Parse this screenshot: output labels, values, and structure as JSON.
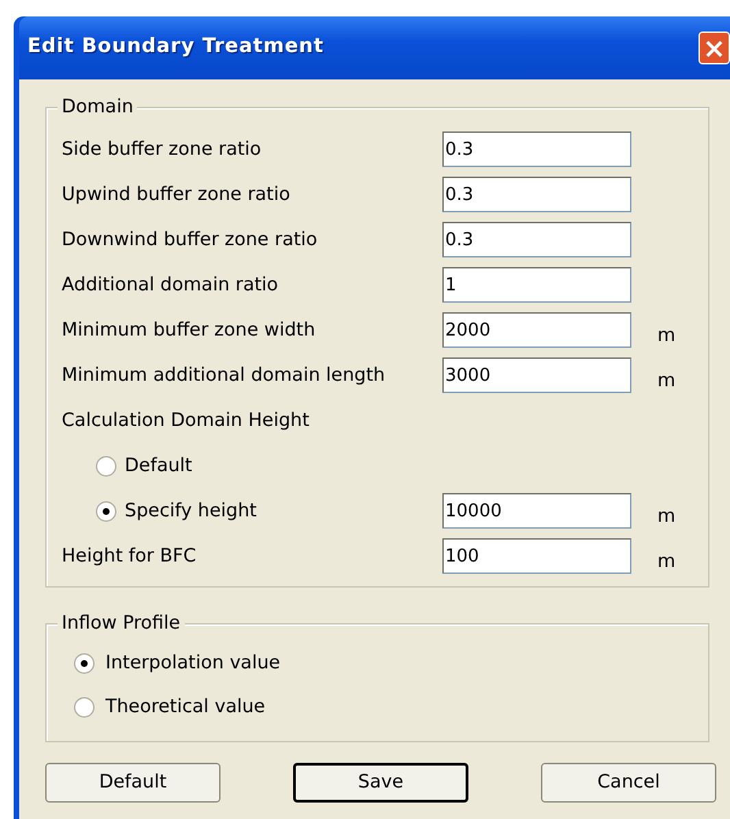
{
  "window": {
    "title": "Edit Boundary Treatment",
    "close": "×"
  },
  "domain": {
    "legend": "Domain",
    "rows": [
      {
        "kind": "field",
        "label": "Side buffer zone ratio",
        "value": "0.3"
      },
      {
        "kind": "field",
        "label": "Upwind buffer zone ratio",
        "value": "0.3"
      },
      {
        "kind": "field",
        "label": "Downwind buffer zone ratio",
        "value": "0.3"
      },
      {
        "kind": "field",
        "label": "Additional domain ratio",
        "value": "1"
      },
      {
        "kind": "field",
        "label": "Minimum buffer zone width",
        "value": "2000",
        "unit": "m"
      },
      {
        "kind": "field",
        "label": "Minimum additional domain length",
        "value": "3000",
        "unit": "m"
      },
      {
        "kind": "heading",
        "label": "Calculation Domain Height"
      },
      {
        "kind": "radio",
        "label": "Default",
        "selected": false
      },
      {
        "kind": "radio",
        "label": "Specify height",
        "selected": true,
        "value": "10000",
        "unit": "m"
      },
      {
        "kind": "field",
        "label": "Height for BFC",
        "value": "100",
        "unit": "m"
      }
    ]
  },
  "inflow": {
    "legend": "Inflow Profile",
    "options": [
      {
        "label": "Interpolation value",
        "selected": true
      },
      {
        "label": "Theoretical value",
        "selected": false
      }
    ]
  },
  "buttons": [
    {
      "label": "Default",
      "default": false
    },
    {
      "label": "Save",
      "default": true
    },
    {
      "label": "Cancel",
      "default": false
    }
  ]
}
